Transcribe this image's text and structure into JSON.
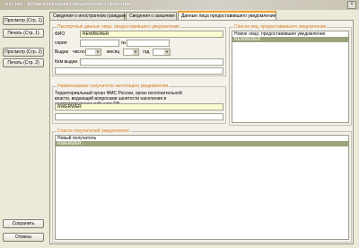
{
  "window": {
    "title": "frm_fafc - Добавление/правка уведомления о прибытии",
    "close_glyph": "×"
  },
  "sidebar": {
    "preview1": "Просмотр (Стр. 1)",
    "print1": "Печать (Стр. 1)",
    "preview2": "Просмотр (Стр. 2)",
    "print2": "Печать (Стр. 2)",
    "save": "Сохранить",
    "cancel": "Отмена"
  },
  "tabs": [
    {
      "label": "Сведения о иностранном гражданине"
    },
    {
      "label": "Сведения о заказчике"
    },
    {
      "label": "Данные лица предоставившего уведомление"
    }
  ],
  "passport": {
    "legend": "Паспортные данные лица, предоставившего уведомление",
    "fio_label": "ФИО",
    "fio_value": "REWRERER",
    "series_label": "серия",
    "series_value": "",
    "number_label": "№",
    "number_value": "",
    "issued_label": "Выдан",
    "day_label": "число",
    "month_label": "месяц",
    "year_label": "год",
    "issuer_label": "Кем выдан",
    "issuer_value": "",
    "issuer_value2": ""
  },
  "recipient": {
    "legend": "Наименование получателя настоящего уведомления",
    "description": "Территориальный орган ФМС России, орган исполнительной власти, ведающий вопросами занятости населения в соответствующем субъекте РФ",
    "value": "RWERWER",
    "value2": ""
  },
  "persons_list": {
    "legend": "Список лиц, предоставившего уведомление",
    "items": [
      "Новое лицо, предоставившее уведомление",
      "REWRERER"
    ],
    "selected_index": 1
  },
  "recipients_list": {
    "legend": "Список получателей уведомления",
    "items": [
      "Новый получатель",
      "RWERWER"
    ],
    "selected_index": 1
  },
  "colors": {
    "legend": "#d47a1e",
    "selection": "#9aa37a",
    "required_field": "#fdfbd2"
  }
}
